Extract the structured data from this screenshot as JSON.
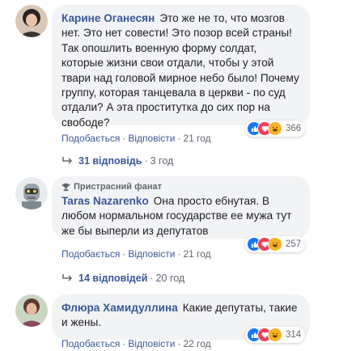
{
  "comments": [
    {
      "author": "Карине Оганесян",
      "text": "Это же не то, что мозгов нет. Это нет совести! Это позор всей страны! Так опошлить военную форму солдат, которые жизни свои отдали, чтобы у этой твари над головой мирное небо было! Почему группу, которая танцевала в церкви - по суд отдали? А эта проститутка до сих пор на свободе?",
      "reaction_count": "366",
      "like_label": "Подобається",
      "reply_label": "Відповісти",
      "time": "21 год",
      "replies_label": "31 відповідь",
      "replies_time": "3 год"
    },
    {
      "badge": "Пристрасний фанат",
      "author": "Taras Nazarenko",
      "text": "Она просто ебнутая. В любом нормальном государстве ее мужа тут же бы выперли из депутатов",
      "reaction_count": "257",
      "like_label": "Подобається",
      "reply_label": "Відповісти",
      "time": "21 год",
      "replies_label": "14 відповідей",
      "replies_time": "20 год"
    },
    {
      "author": "Флюра Хамидуллина",
      "text": "Какие депутаты, такие и жены.",
      "reaction_count": "314",
      "like_label": "Подобається",
      "reply_label": "Відповісти",
      "time": "22 год"
    }
  ],
  "separator": "·",
  "colors": {
    "link": "#385898",
    "meta": "#606770",
    "bubble": "#f2f3f5",
    "like": "#1877f2",
    "love": "#f33e58",
    "haha": "#f7b125"
  }
}
